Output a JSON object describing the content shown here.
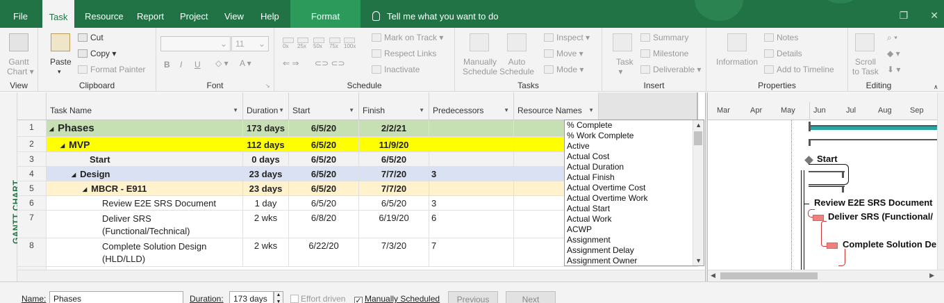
{
  "ribbon_tabs": [
    "File",
    "Task",
    "Resource",
    "Report",
    "Project",
    "View",
    "Help",
    "Format"
  ],
  "tell_me": "Tell me what you want to do",
  "groups": {
    "view": {
      "label": "View",
      "gantt": "Gantt",
      "chart": "Chart"
    },
    "clipboard": {
      "label": "Clipboard",
      "paste": "Paste",
      "cut": "Cut",
      "copy": "Copy",
      "format_painter": "Format Painter"
    },
    "font": {
      "label": "Font",
      "size": "11",
      "bold": "B",
      "italic": "I",
      "underline": "U"
    },
    "schedule": {
      "label": "Schedule",
      "pcts": [
        "0x",
        "25x",
        "50x",
        "75x",
        "100x"
      ],
      "mark_on_track": "Mark on Track",
      "respect_links": "Respect Links",
      "inactivate": "Inactivate"
    },
    "tasks": {
      "label": "Tasks",
      "manually": "Manually",
      "auto": "Auto",
      "schedule": "Schedule",
      "inspect": "Inspect",
      "move": "Move",
      "mode": "Mode"
    },
    "insert": {
      "label": "Insert",
      "task": "Task",
      "summary": "Summary",
      "milestone": "Milestone",
      "deliverable": "Deliverable"
    },
    "properties": {
      "label": "Properties",
      "information": "Information",
      "notes": "Notes",
      "details": "Details",
      "add_to_timeline": "Add to Timeline"
    },
    "editing": {
      "label": "Editing",
      "scroll": "Scroll",
      "to_task": "to Task"
    }
  },
  "view_bar": "GANTT CHART",
  "columns": [
    "Task Name",
    "Duration",
    "Start",
    "Finish",
    "Predecessors",
    "Resource Names"
  ],
  "rows": [
    {
      "id": "1",
      "name": "Phases",
      "duration": "173 days",
      "start": "6/5/20",
      "finish": "2/2/21",
      "pred": ""
    },
    {
      "id": "2",
      "name": "MVP",
      "duration": "112 days",
      "start": "6/5/20",
      "finish": "11/9/20",
      "pred": ""
    },
    {
      "id": "3",
      "name": "Start",
      "duration": "0 days",
      "start": "6/5/20",
      "finish": "6/5/20",
      "pred": ""
    },
    {
      "id": "4",
      "name": "Design",
      "duration": "23 days",
      "start": "6/5/20",
      "finish": "7/7/20",
      "pred": "3"
    },
    {
      "id": "5",
      "name": "MBCR - E911",
      "duration": "23 days",
      "start": "6/5/20",
      "finish": "7/7/20",
      "pred": ""
    },
    {
      "id": "6",
      "name": "Review E2E SRS Document",
      "duration": "1 day",
      "start": "6/5/20",
      "finish": "6/5/20",
      "pred": "3"
    },
    {
      "id": "7",
      "name": "Deliver SRS",
      "name2": "(Functional/Technical)",
      "duration": "2 wks",
      "start": "6/8/20",
      "finish": "6/19/20",
      "pred": "6"
    },
    {
      "id": "8",
      "name": "Complete Solution Design",
      "name2": "(HLD/LLD)",
      "duration": "2 wks",
      "start": "6/22/20",
      "finish": "7/3/20",
      "pred": "7"
    }
  ],
  "field_list": [
    "% Complete",
    "% Work Complete",
    "Active",
    "Actual Cost",
    "Actual Duration",
    "Actual Finish",
    "Actual Overtime Cost",
    "Actual Overtime Work",
    "Actual Start",
    "Actual Work",
    "ACWP",
    "Assignment",
    "Assignment Delay",
    "Assignment Owner"
  ],
  "timescale": [
    "Mar",
    "Apr",
    "May",
    "Jun",
    "Jul",
    "Aug",
    "Sep"
  ],
  "gantt_labels": {
    "start": "Start",
    "review": "Review E2E SRS Document",
    "deliver": "Deliver SRS (Functional/",
    "complete": "Complete Solution De"
  },
  "form": {
    "name_label": "Name:",
    "name_value": "Phases",
    "duration_label": "Duration:",
    "duration_value": "173 days",
    "effort_driven": "Effort driven",
    "manually_scheduled": "Manually Scheduled",
    "previous": "Previous",
    "next": "Next"
  },
  "colors": {
    "accent": "#217346",
    "summary_green": "#c6e0b4",
    "highlight_yellow": "#ffff00",
    "design_blue": "#d9e1f2",
    "mbcr_tan": "#fff2cc",
    "bar_teal": "#2aa3a3",
    "bar_red": "#f08080"
  }
}
